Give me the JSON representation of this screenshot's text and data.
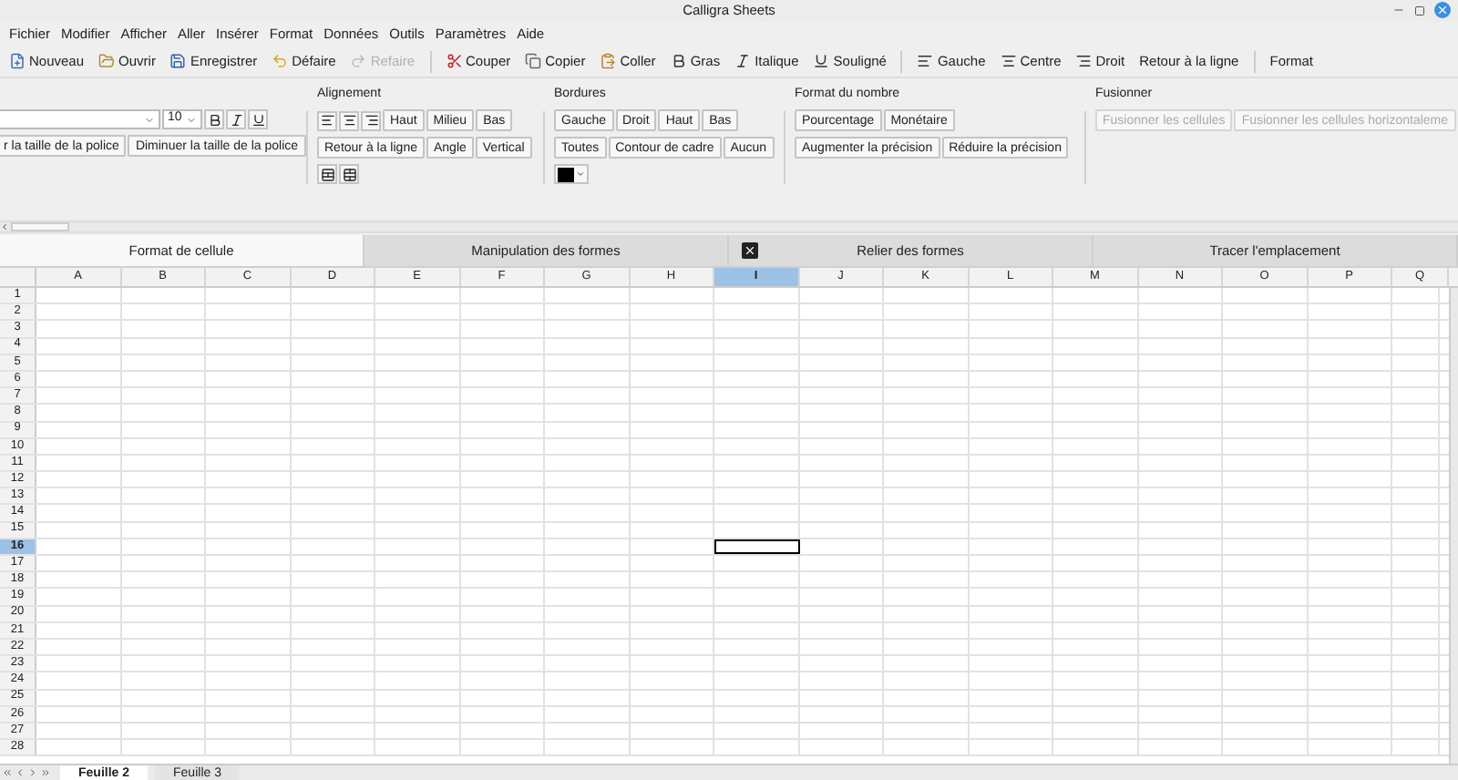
{
  "window": {
    "title": "Calligra Sheets"
  },
  "menu": [
    "Fichier",
    "Modifier",
    "Afficher",
    "Aller",
    "Insérer",
    "Format",
    "Données",
    "Outils",
    "Paramètres",
    "Aide"
  ],
  "toolbar": [
    {
      "kind": "button",
      "label": "Nouveau",
      "disabled": false
    },
    {
      "kind": "button",
      "label": "Ouvrir",
      "disabled": false
    },
    {
      "kind": "button",
      "label": "Enregistrer",
      "disabled": false
    },
    {
      "kind": "button",
      "label": "Défaire",
      "disabled": false
    },
    {
      "kind": "button",
      "label": "Refaire",
      "disabled": true
    },
    {
      "kind": "separator"
    },
    {
      "kind": "button",
      "label": "Couper",
      "disabled": false
    },
    {
      "kind": "button",
      "label": "Copier",
      "disabled": false
    },
    {
      "kind": "button",
      "label": "Coller",
      "disabled": false
    },
    {
      "kind": "button",
      "label": "Gras",
      "disabled": false
    },
    {
      "kind": "button",
      "label": "Italique",
      "disabled": false
    },
    {
      "kind": "button",
      "label": "Souligné",
      "disabled": false
    },
    {
      "kind": "separator"
    },
    {
      "kind": "button",
      "label": "Gauche",
      "disabled": false
    },
    {
      "kind": "button",
      "label": "Centre",
      "disabled": false
    },
    {
      "kind": "button",
      "label": "Droit",
      "disabled": false
    },
    {
      "kind": "text",
      "label": "Retour à la ligne",
      "disabled": false
    },
    {
      "kind": "separator"
    },
    {
      "kind": "text",
      "label": "Format",
      "disabled": false
    }
  ],
  "ribbon": [
    {
      "lines": [
        {
          "controls": [
            {
              "kind": "combo"
            },
            {
              "kind": "combo",
              "value": "10"
            },
            {
              "kind": "icon",
              "disabled": false
            },
            {
              "kind": "icon",
              "disabled": false
            },
            {
              "kind": "icon",
              "disabled": false
            }
          ]
        },
        {
          "controls": [
            {
              "kind": "button",
              "label": "r la taille de la police",
              "disabled": false
            },
            {
              "kind": "button",
              "label": "Diminuer la taille de la police",
              "disabled": false
            }
          ]
        }
      ]
    },
    {
      "title": "Alignement",
      "lines": [
        {
          "controls": [
            {
              "kind": "icon",
              "disabled": false
            },
            {
              "kind": "icon",
              "disabled": false
            },
            {
              "kind": "icon",
              "disabled": false
            },
            {
              "kind": "button",
              "label": "Haut",
              "disabled": false
            },
            {
              "kind": "button",
              "label": "Milieu",
              "disabled": false
            },
            {
              "kind": "button",
              "label": "Bas",
              "disabled": false
            }
          ]
        },
        {
          "controls": [
            {
              "kind": "button",
              "label": "Retour à la ligne",
              "disabled": false
            },
            {
              "kind": "button",
              "label": "Angle",
              "disabled": false
            },
            {
              "kind": "button",
              "label": "Vertical",
              "disabled": false
            }
          ]
        },
        {
          "controls": [
            {
              "kind": "icon",
              "disabled": false
            },
            {
              "kind": "icon",
              "disabled": false
            }
          ]
        }
      ]
    },
    {
      "title": "Bordures",
      "lines": [
        {
          "controls": [
            {
              "kind": "button",
              "label": "Gauche",
              "disabled": false
            },
            {
              "kind": "button",
              "label": "Droit",
              "disabled": false
            },
            {
              "kind": "button",
              "label": "Haut",
              "disabled": false
            },
            {
              "kind": "button",
              "label": "Bas",
              "disabled": false
            }
          ]
        },
        {
          "controls": [
            {
              "kind": "button",
              "label": "Toutes",
              "disabled": false
            },
            {
              "kind": "button",
              "label": "Contour de cadre",
              "disabled": false
            },
            {
              "kind": "button",
              "label": "Aucun",
              "disabled": false
            }
          ]
        },
        {
          "controls": [
            {
              "kind": "color",
              "color": "#000000"
            }
          ]
        }
      ]
    },
    {
      "title": "Format du nombre",
      "lines": [
        {
          "controls": [
            {
              "kind": "button",
              "label": "Pourcentage",
              "disabled": false
            },
            {
              "kind": "button",
              "label": "Monétaire",
              "disabled": false
            }
          ]
        },
        {
          "controls": [
            {
              "kind": "button",
              "label": "Augmenter la précision",
              "disabled": false
            },
            {
              "kind": "button",
              "label": "Réduire la précision",
              "disabled": false
            }
          ]
        }
      ]
    },
    {
      "title": "Fusionner",
      "lines": [
        {
          "controls": [
            {
              "kind": "button",
              "label": "Fusionner les cellules",
              "disabled": true
            },
            {
              "kind": "button",
              "label": "Fusionner les cellules horizontaleme",
              "disabled": true
            }
          ]
        }
      ]
    }
  ],
  "tabs": [
    {
      "label": "Format de cellule",
      "selected": true
    },
    {
      "label": "Manipulation des formes",
      "selected": false
    },
    {
      "label": "Relier des formes",
      "selected": false
    },
    {
      "label": "Tracer l'emplacement",
      "selected": false
    }
  ],
  "grid": {
    "columns": [
      {
        "label": "A",
        "selected": false
      },
      {
        "label": "B",
        "selected": false
      },
      {
        "label": "C",
        "selected": false
      },
      {
        "label": "D",
        "selected": false
      },
      {
        "label": "E",
        "selected": false
      },
      {
        "label": "F",
        "selected": false
      },
      {
        "label": "G",
        "selected": false
      },
      {
        "label": "H",
        "selected": false
      },
      {
        "label": "I",
        "selected": true
      },
      {
        "label": "J",
        "selected": false
      },
      {
        "label": "K",
        "selected": false
      },
      {
        "label": "L",
        "selected": false
      },
      {
        "label": "M",
        "selected": false
      },
      {
        "label": "N",
        "selected": false
      },
      {
        "label": "O",
        "selected": false
      },
      {
        "label": "P",
        "selected": false
      },
      {
        "label": "Q",
        "selected": false
      }
    ],
    "rows": [
      {
        "label": "1",
        "selected": false
      },
      {
        "label": "2",
        "selected": false
      },
      {
        "label": "3",
        "selected": false
      },
      {
        "label": "4",
        "selected": false
      },
      {
        "label": "5",
        "selected": false
      },
      {
        "label": "6",
        "selected": false
      },
      {
        "label": "7",
        "selected": false
      },
      {
        "label": "8",
        "selected": false
      },
      {
        "label": "9",
        "selected": false
      },
      {
        "label": "10",
        "selected": false
      },
      {
        "label": "11",
        "selected": false
      },
      {
        "label": "12",
        "selected": false
      },
      {
        "label": "13",
        "selected": false
      },
      {
        "label": "14",
        "selected": false
      },
      {
        "label": "15",
        "selected": false
      },
      {
        "label": "16",
        "selected": true
      },
      {
        "label": "17",
        "selected": false
      },
      {
        "label": "18",
        "selected": false
      },
      {
        "label": "19",
        "selected": false
      },
      {
        "label": "20",
        "selected": false
      },
      {
        "label": "21",
        "selected": false
      },
      {
        "label": "22",
        "selected": false
      },
      {
        "label": "23",
        "selected": false
      },
      {
        "label": "24",
        "selected": false
      },
      {
        "label": "25",
        "selected": false
      },
      {
        "label": "26",
        "selected": false
      },
      {
        "label": "27",
        "selected": false
      },
      {
        "label": "28",
        "selected": false
      }
    ]
  },
  "sheets": [
    {
      "label": "Feuille 2",
      "selected": true
    },
    {
      "label": "Feuille 3",
      "selected": false
    }
  ]
}
